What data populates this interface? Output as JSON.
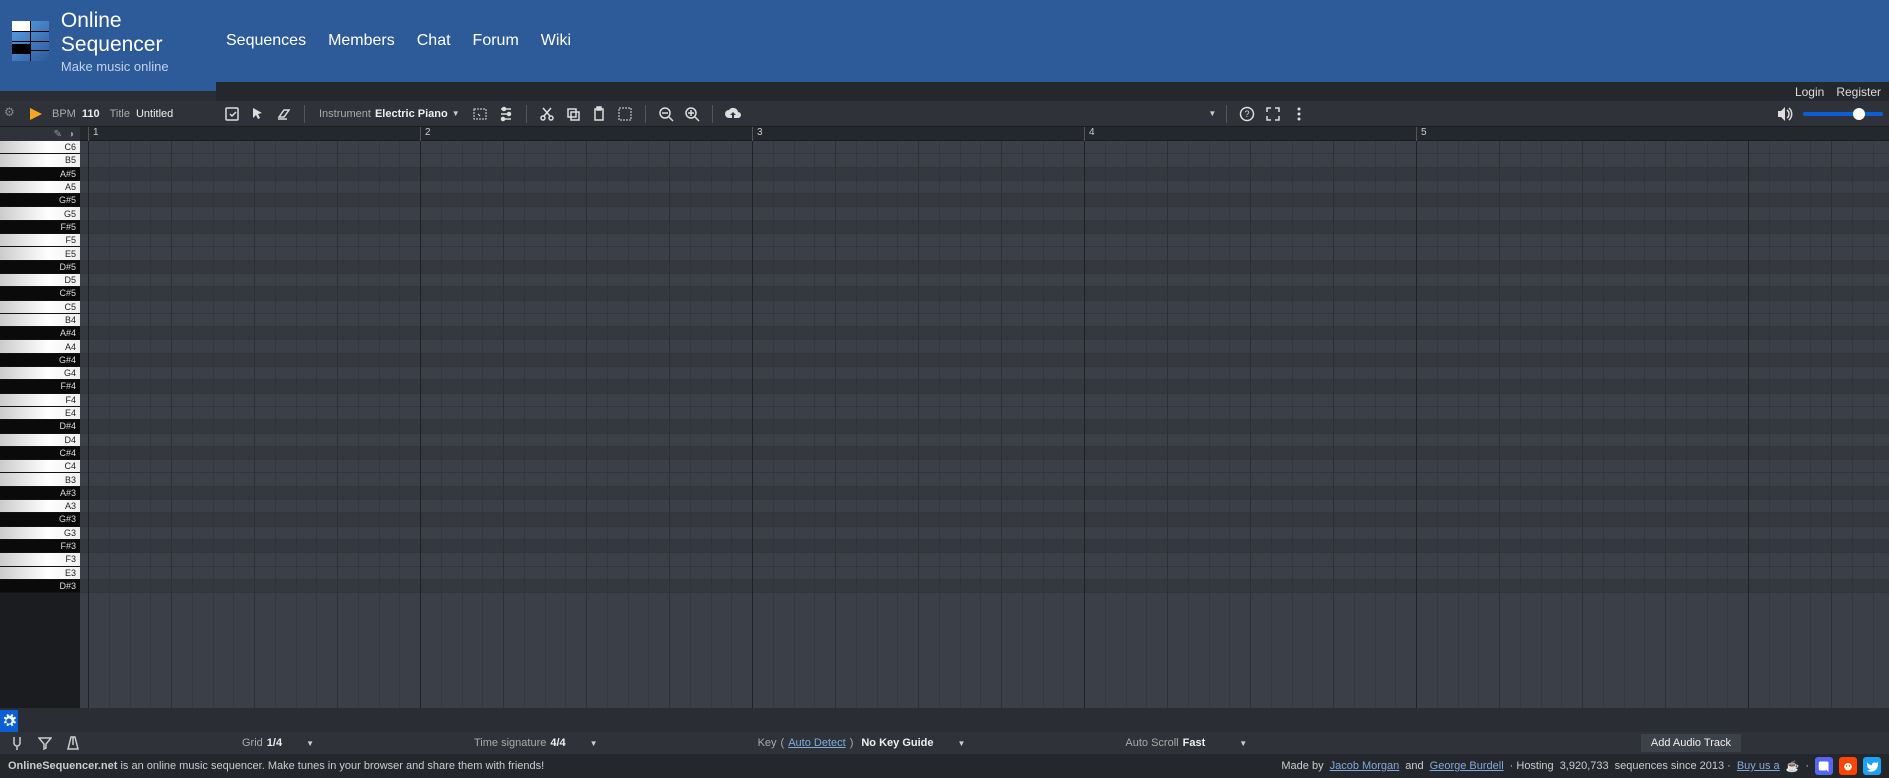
{
  "header": {
    "title": "Online Sequencer",
    "tagline": "Make music online",
    "nav": [
      "Sequences",
      "Members",
      "Chat",
      "Forum",
      "Wiki"
    ]
  },
  "auth": {
    "login": "Login",
    "register": "Register"
  },
  "toolbar": {
    "bpm_label": "BPM",
    "bpm_value": "110",
    "title_label": "Title",
    "title_value": "Untitled",
    "instrument_label": "Instrument",
    "instrument_value": "Electric Piano"
  },
  "ruler": {
    "marks": [
      1,
      2,
      3,
      4,
      5
    ]
  },
  "piano_keys": [
    {
      "n": "C6",
      "b": false
    },
    {
      "n": "B5",
      "b": false
    },
    {
      "n": "A#5",
      "b": true
    },
    {
      "n": "A5",
      "b": false
    },
    {
      "n": "G#5",
      "b": true
    },
    {
      "n": "G5",
      "b": false
    },
    {
      "n": "F#5",
      "b": true
    },
    {
      "n": "F5",
      "b": false
    },
    {
      "n": "E5",
      "b": false
    },
    {
      "n": "D#5",
      "b": true
    },
    {
      "n": "D5",
      "b": false
    },
    {
      "n": "C#5",
      "b": true
    },
    {
      "n": "C5",
      "b": false
    },
    {
      "n": "B4",
      "b": false
    },
    {
      "n": "A#4",
      "b": true
    },
    {
      "n": "A4",
      "b": false
    },
    {
      "n": "G#4",
      "b": true
    },
    {
      "n": "G4",
      "b": false
    },
    {
      "n": "F#4",
      "b": true
    },
    {
      "n": "F4",
      "b": false
    },
    {
      "n": "E4",
      "b": false
    },
    {
      "n": "D#4",
      "b": true
    },
    {
      "n": "D4",
      "b": false
    },
    {
      "n": "C#4",
      "b": true
    },
    {
      "n": "C4",
      "b": false
    },
    {
      "n": "B3",
      "b": false
    },
    {
      "n": "A#3",
      "b": true
    },
    {
      "n": "A3",
      "b": false
    },
    {
      "n": "G#3",
      "b": true
    },
    {
      "n": "G3",
      "b": false
    },
    {
      "n": "F#3",
      "b": true
    },
    {
      "n": "F3",
      "b": false
    },
    {
      "n": "E3",
      "b": false
    },
    {
      "n": "D#3",
      "b": true
    }
  ],
  "bottom": {
    "grid_label": "Grid",
    "grid_value": "1/4",
    "ts_label": "Time signature",
    "ts_value": "4/4",
    "key_label": "Key",
    "auto_detect": "Auto Detect",
    "key_guide": "No Key Guide",
    "scroll_label": "Auto Scroll",
    "scroll_value": "Fast",
    "add_track": "Add Audio Track"
  },
  "footer": {
    "left_bold": "OnlineSequencer.net",
    "left_rest": " is an online music sequencer. Make tunes in your browser and share them with friends!",
    "made_by": "Made by ",
    "author1": "Jacob Morgan",
    "and": " and ",
    "author2": "George Burdell",
    "hosting": " · Hosting ",
    "seq_count": "3,920,733",
    "since": " sequences since 2013 · ",
    "buy": "Buy us a ",
    "coffee_icon": "☕",
    "sep": " · "
  }
}
